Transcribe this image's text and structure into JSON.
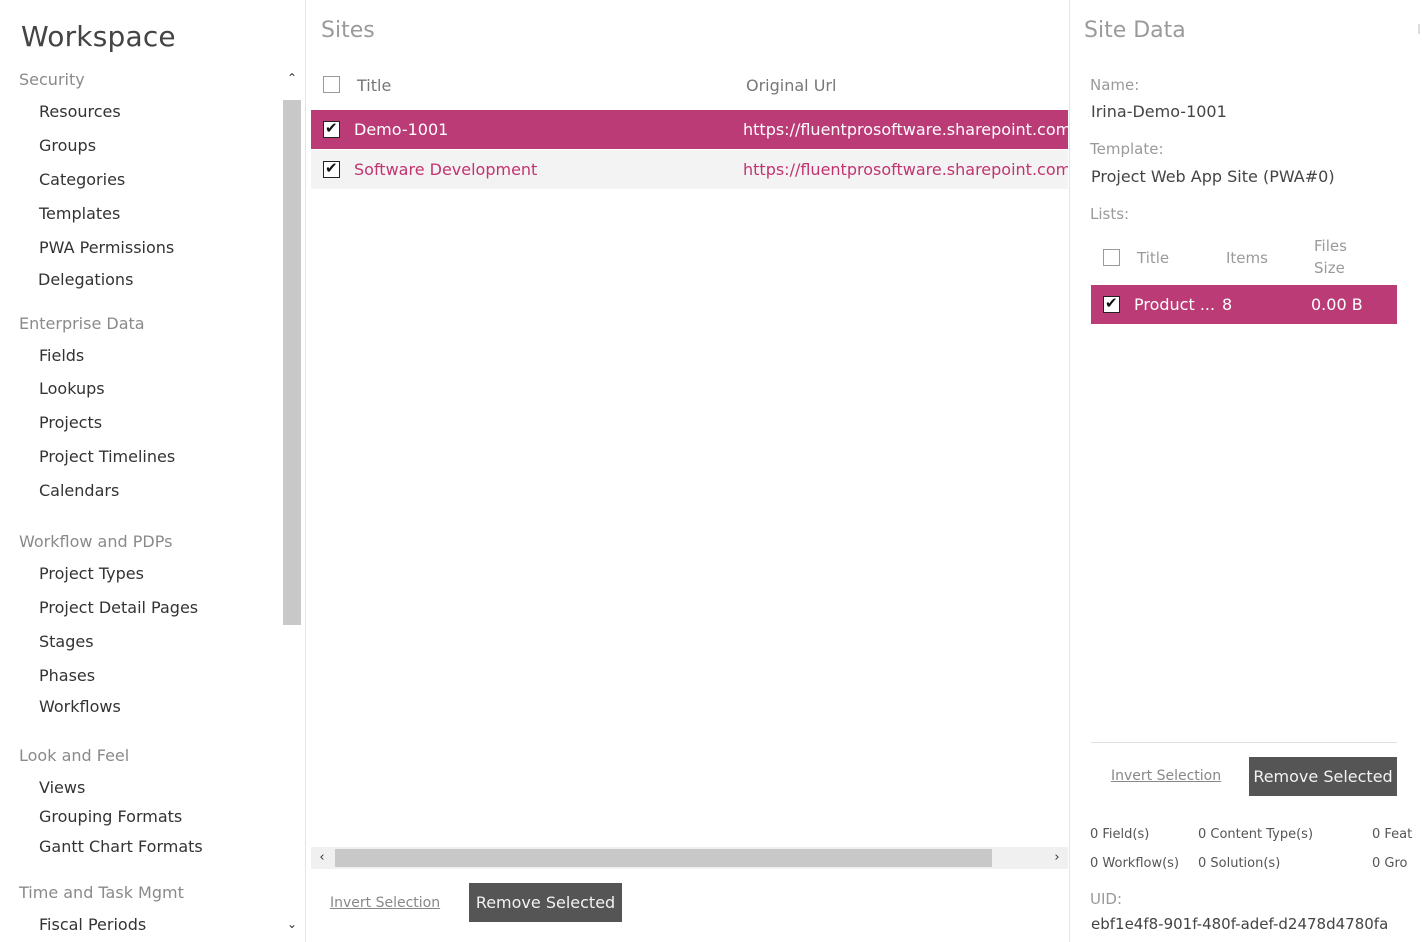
{
  "nav": {
    "title": "Workspace",
    "groups": [
      {
        "label": "Security",
        "items": [
          "Resources",
          "Groups",
          "Categories",
          "Templates",
          "PWA Permissions",
          "Delegations"
        ]
      },
      {
        "label": "Enterprise Data",
        "items": [
          "Fields",
          "Lookups",
          "Projects",
          "Project Timelines",
          "Calendars"
        ]
      },
      {
        "label": "Workflow and PDPs",
        "items": [
          "Project Types",
          "Project Detail Pages",
          "Stages",
          "Phases",
          "Workflows"
        ]
      },
      {
        "label": "Look and Feel",
        "items": [
          "Views",
          "Grouping Formats",
          "Gantt Chart Formats"
        ]
      },
      {
        "label": "Time and Task Mgmt",
        "items": [
          "Fiscal Periods"
        ]
      }
    ],
    "scroll_up_icon": "chevron-up-icon",
    "scroll_down_icon": "chevron-down-icon"
  },
  "sites": {
    "title": "Sites",
    "columns": {
      "title": "Title",
      "url": "Original Url"
    },
    "rows": [
      {
        "title": "Demo-1001",
        "url": "https://fluentprosoftware.sharepoint.com/s",
        "checked": true,
        "selected": true
      },
      {
        "title": "Software Development",
        "url": "https://fluentprosoftware.sharepoint.com/s",
        "checked": true,
        "selected": false
      }
    ],
    "invert_label": "Invert Selection",
    "remove_label": "Remove Selected"
  },
  "site_data": {
    "title": "Site Data",
    "name_label": "Name:",
    "name_value": "Irina-Demo-1001",
    "template_label": "Template:",
    "template_value": "Project Web App Site (PWA#0)",
    "lists_label": "Lists:",
    "list_columns": {
      "title": "Title",
      "items": "Items",
      "files_size_1": "Files",
      "files_size_2": "Size"
    },
    "list_rows": [
      {
        "title": "Product ...",
        "items": "8",
        "size": "0.00 B",
        "checked": true
      }
    ],
    "invert_label": "Invert Selection",
    "remove_label": "Remove Selected",
    "stats": {
      "fields": "0 Field(s)",
      "content_types": "0 Content Type(s)",
      "features": "0 Feat",
      "workflows": "0 Workflow(s)",
      "solutions": "0 Solution(s)",
      "groups": "0 Gro"
    },
    "uid_label": "UID:",
    "uid_value": "ebf1e4f8-901f-480f-adef-d2478d4780fa"
  },
  "colors": {
    "accent": "#bb3b77",
    "link_text": "#c2336f",
    "button_bg": "#555555"
  }
}
